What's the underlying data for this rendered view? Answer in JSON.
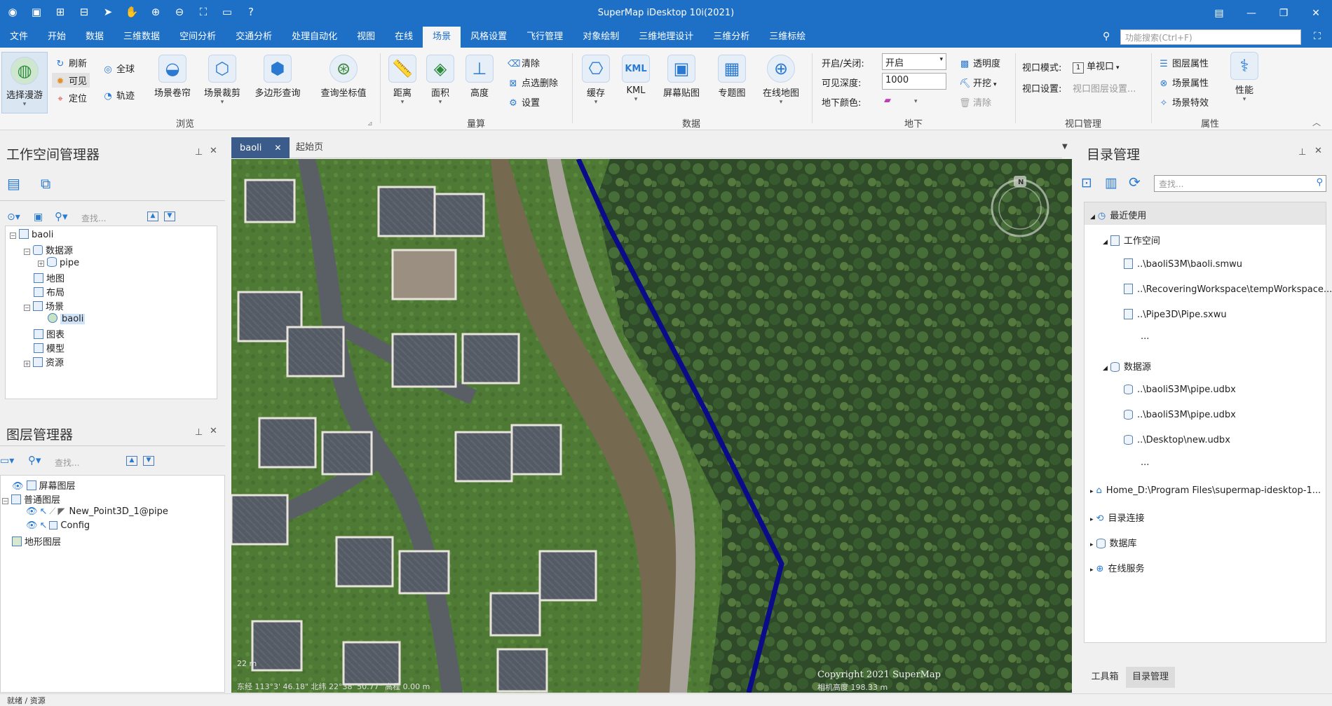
{
  "app": {
    "title": "SuperMap iDesktop 10i(2021)"
  },
  "menu": {
    "tabs": [
      "文件",
      "开始",
      "数据",
      "三维数据",
      "空间分析",
      "交通分析",
      "处理自动化",
      "视图",
      "在线",
      "场景",
      "风格设置",
      "飞行管理",
      "对象绘制",
      "三维地理设计",
      "三维分析",
      "三维标绘"
    ],
    "active": "场景",
    "search_placeholder": "功能搜索(Ctrl+F)"
  },
  "ribbon": {
    "browse": {
      "select_roam": "选择漫游",
      "refresh": "刷新",
      "visible": "可见",
      "locate": "定位",
      "globe": "全球",
      "track": "轨迹",
      "scene_roller": "场景卷帘",
      "scene_clip": "场景裁剪",
      "polygon_query": "多边形查询",
      "query_coord": "查询坐标值",
      "group": "浏览"
    },
    "measure": {
      "distance": "距离",
      "area": "面积",
      "height": "高度",
      "clear": "清除",
      "point_delete": "点选删除",
      "settings": "设置",
      "group": "量算"
    },
    "data": {
      "cache": "缓存",
      "kml": "KML",
      "screen_map": "屏幕贴图",
      "thematic": "专题图",
      "online_map": "在线地图",
      "group": "数据"
    },
    "underground": {
      "toggle_label": "开启/关闭:",
      "toggle_value": "开启",
      "depth_label": "可见深度:",
      "depth_value": "1000",
      "color_label": "地下颜色:",
      "transparency": "透明度",
      "excavate": "开挖",
      "clear": "清除",
      "group": "地下"
    },
    "viewport": {
      "mode_label": "视口模式:",
      "mode_value": "单视口",
      "settings_label": "视口设置:",
      "settings_value": "视口图层设置...",
      "group": "视口管理"
    },
    "properties": {
      "layer_props": "图层属性",
      "scene_props": "场景属性",
      "scene_effects": "场景特效",
      "performance": "性能",
      "group": "属性"
    }
  },
  "workspace_panel": {
    "title": "工作空间管理器",
    "search_placeholder": "查找...",
    "tree": {
      "root": "baoli",
      "datasources": "数据源",
      "pipe": "pipe",
      "maps": "地图",
      "layouts": "布局",
      "scenes": "场景",
      "scene_baoli": "baoli",
      "charts": "图表",
      "models": "模型",
      "resources": "资源"
    }
  },
  "layer_panel": {
    "title": "图层管理器",
    "search_placeholder": "查找...",
    "tree": {
      "screen_layers": "屏幕图层",
      "normal_layers": "普通图层",
      "point_layer": "New_Point3D_1@pipe",
      "config": "Config",
      "terrain_layers": "地形图层"
    }
  },
  "doc_tabs": {
    "active": "baoli",
    "start": "起始页"
  },
  "map": {
    "copyright": "Copyright 2021 SuperMap",
    "scale": "22 m",
    "coords": "东经 113°3' 46.18\" 北纬 22°38' 50.77\" 高程 0.00 m",
    "camera": "相机高度 198.33 m",
    "compass": "N"
  },
  "catalog_panel": {
    "title": "目录管理",
    "search_placeholder": "查找...",
    "tree": {
      "recent": "最近使用",
      "workspace": "工作空间",
      "ws1": "..\\baoliS3M\\baoli.smwu",
      "ws2": "..\\RecoveringWorkspace\\tempWorkspace....",
      "ws3": "..\\Pipe3D\\Pipe.sxwu",
      "ws_more": "...",
      "datasource": "数据源",
      "ds1": "..\\baoliS3M\\pipe.udbx",
      "ds2": "..\\baoliS3M\\pipe.udbx",
      "ds3": "..\\Desktop\\new.udbx",
      "ds_more": "...",
      "home": "Home_D:\\Program Files\\supermap-idesktop-1...",
      "dir_conn": "目录连接",
      "database": "数据库",
      "online": "在线服务"
    },
    "bottom_tabs": [
      "工具箱",
      "目录管理"
    ]
  },
  "status": {
    "text": "就绪 / 资源"
  }
}
